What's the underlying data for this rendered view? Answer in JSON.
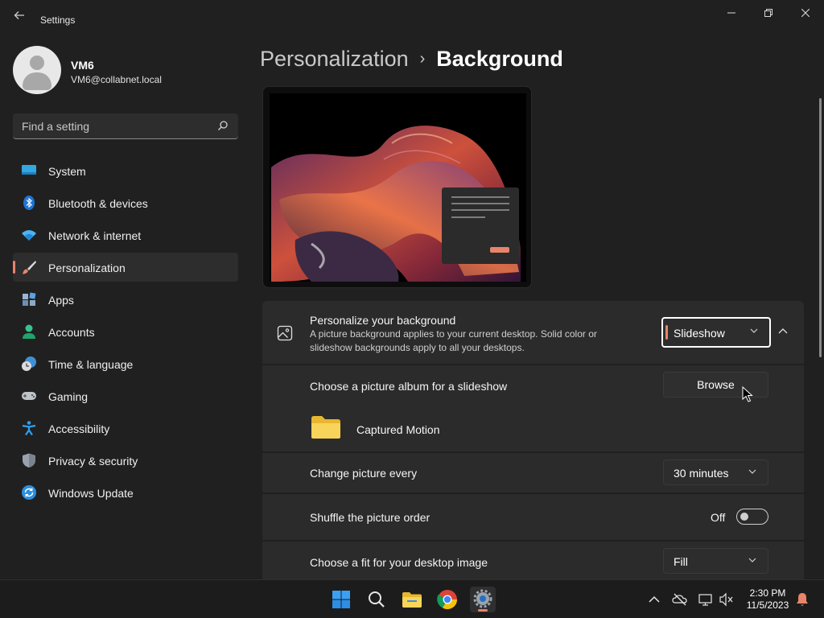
{
  "window": {
    "app_title": "Settings",
    "back_icon": "back-arrow-icon",
    "controls": [
      "minimize-icon",
      "restore-icon",
      "close-icon"
    ]
  },
  "profile": {
    "name": "VM6",
    "email": "VM6@collabnet.local"
  },
  "search": {
    "placeholder": "Find a setting",
    "icon": "search-icon"
  },
  "nav": {
    "items": [
      {
        "label": "System",
        "icon": "system-icon"
      },
      {
        "label": "Bluetooth & devices",
        "icon": "bluetooth-icon"
      },
      {
        "label": "Network & internet",
        "icon": "wifi-icon"
      },
      {
        "label": "Personalization",
        "icon": "paintbrush-icon",
        "active": true
      },
      {
        "label": "Apps",
        "icon": "apps-icon"
      },
      {
        "label": "Accounts",
        "icon": "accounts-icon"
      },
      {
        "label": "Time & language",
        "icon": "globe-clock-icon"
      },
      {
        "label": "Gaming",
        "icon": "gamepad-icon"
      },
      {
        "label": "Accessibility",
        "icon": "accessibility-icon"
      },
      {
        "label": "Privacy & security",
        "icon": "shield-icon"
      },
      {
        "label": "Windows Update",
        "icon": "update-icon"
      }
    ]
  },
  "breadcrumb": {
    "parent": "Personalization",
    "separator": "›",
    "current": "Background"
  },
  "background": {
    "personalize_title": "Personalize your background",
    "personalize_desc": "A picture background applies to your current desktop. Solid color or slideshow backgrounds apply to all your desktops.",
    "personalize_value": "Slideshow",
    "album_label": "Choose a picture album for a slideshow",
    "browse_label": "Browse",
    "album_name": "Captured Motion",
    "change_label": "Change picture every",
    "change_value": "30 minutes",
    "shuffle_label": "Shuffle the picture order",
    "shuffle_state": "Off",
    "fit_label": "Choose a fit for your desktop image",
    "fit_value": "Fill"
  },
  "clock": {
    "time": "2:30 PM",
    "date": "11/5/2023"
  },
  "colors": {
    "accent": "#e8846a",
    "background": "#202020",
    "card": "#2b2b2b"
  }
}
